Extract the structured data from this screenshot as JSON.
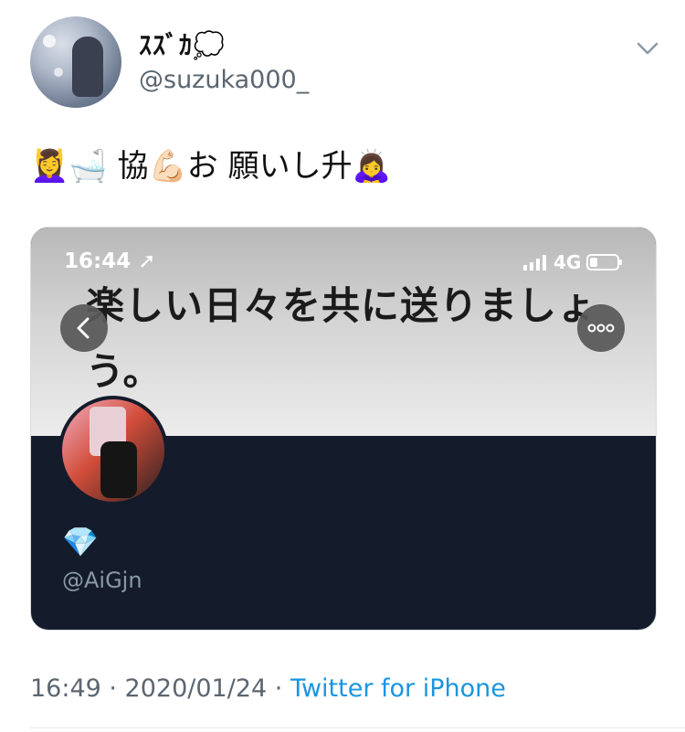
{
  "tweet": {
    "display_name": "ｽｽﾞｶ💭",
    "handle": "@suzuka000_",
    "text": "💆‍♀️🛁 協💪🏻お 願いし升🙇‍♀️",
    "timestamp": "16:49 · 2020/01/24 · ",
    "source": "Twitter for iPhone"
  },
  "card": {
    "status_time": "16:44 ➚",
    "network": "4G",
    "heading": "楽しい日々を共に送りましょう。",
    "diamond_emoji": "💎",
    "handle": "@AiGjn"
  },
  "icons": {
    "menu": "chevron-down-icon",
    "back": "chevron-left-icon",
    "more": "ellipsis-icon"
  },
  "colors": {
    "link": "#1b95e0",
    "secondary_text": "#5b6670",
    "card_dark": "#141b2b"
  }
}
